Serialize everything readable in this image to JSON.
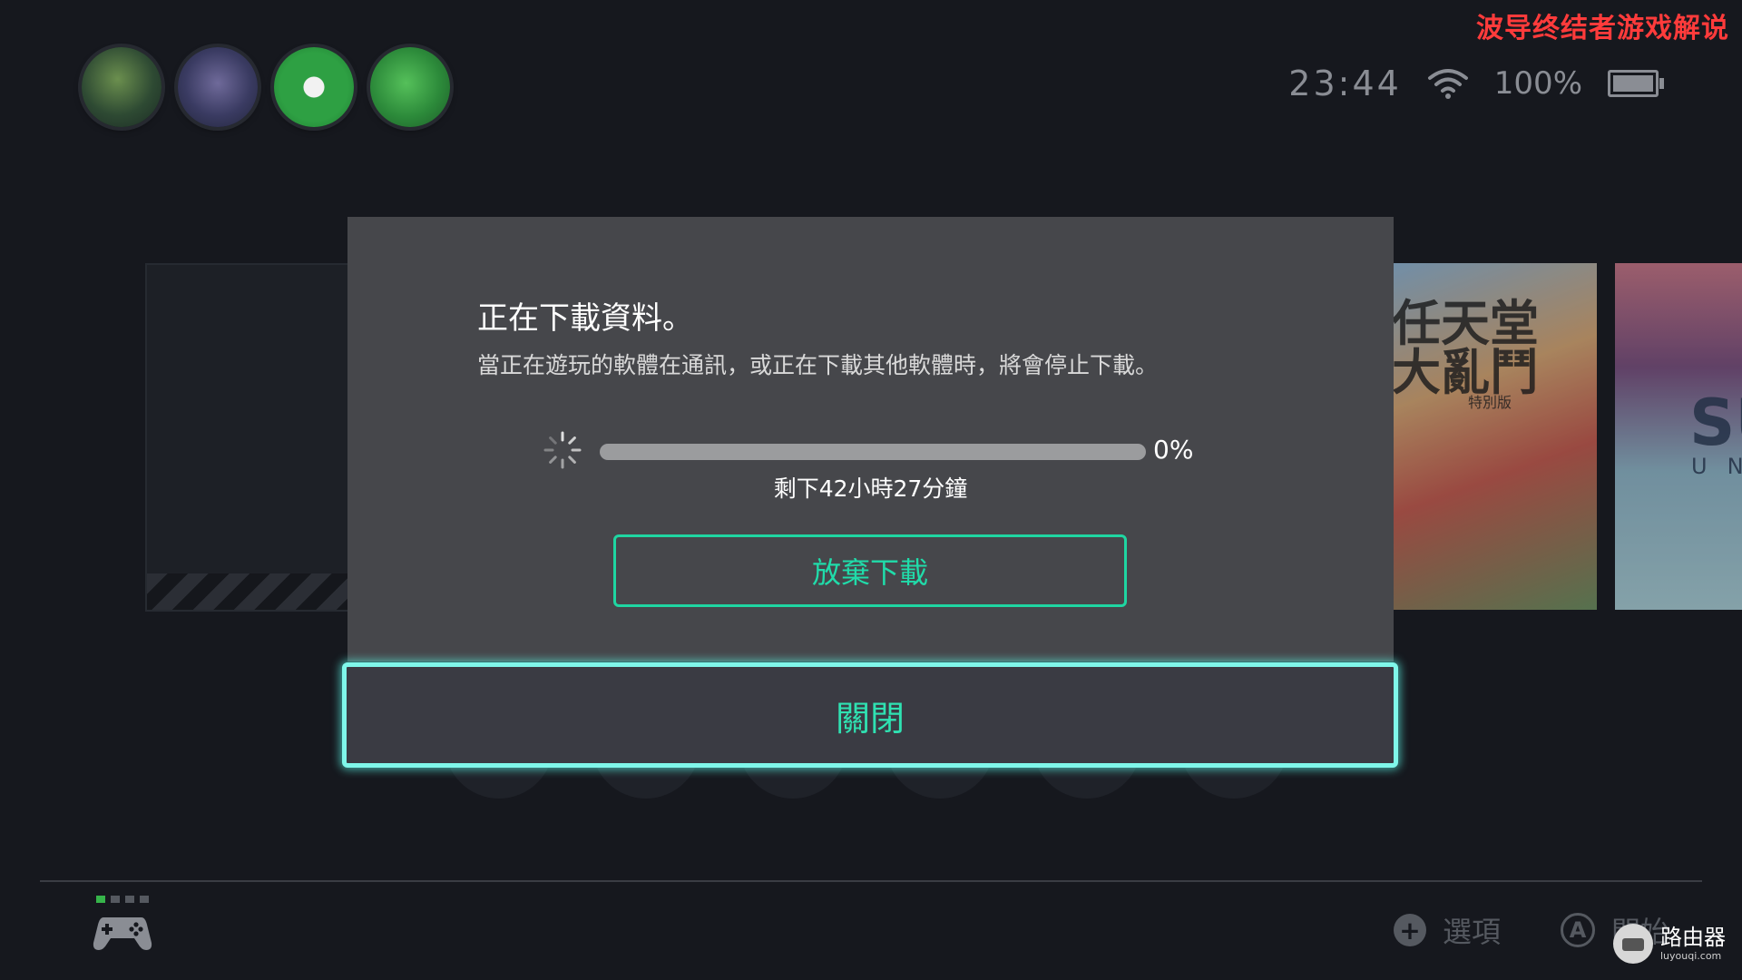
{
  "watermark": "波导终结者游戏解说",
  "status": {
    "time": "23:44",
    "battery_percent": "100%",
    "battery_level": 1.0,
    "wifi_icon": "wifi-icon"
  },
  "users": [
    {
      "name": "avatar-link"
    },
    {
      "name": "avatar-shield"
    },
    {
      "name": "avatar-yoshi-egg"
    },
    {
      "name": "avatar-yoshi"
    }
  ],
  "tiles": {
    "smash_title": "任天堂\n大亂鬥",
    "smash_sub": "特別版",
    "right_big": "SU",
    "right_small": "UN"
  },
  "dialog": {
    "heading": "正在下載資料。",
    "description": "當正在遊玩的軟體在通訊，或正在下載其他軟體時，將會停止下載。",
    "progress_value": 0,
    "progress_label": "0%",
    "remaining": "剩下42小時27分鐘",
    "abort_label": "放棄下載",
    "close_label": "關閉"
  },
  "footer": {
    "options_label": "選項",
    "start_label": "開始",
    "plus_icon": "+",
    "a_icon": "A"
  },
  "logo": {
    "main": "路由器",
    "sub": "luyouqi.com"
  },
  "colors": {
    "accent": "#20dcaa",
    "focus_border": "#7ff7ea",
    "background": "#16181e",
    "dialog": "#46474b",
    "watermark": "#ff3b3b"
  }
}
